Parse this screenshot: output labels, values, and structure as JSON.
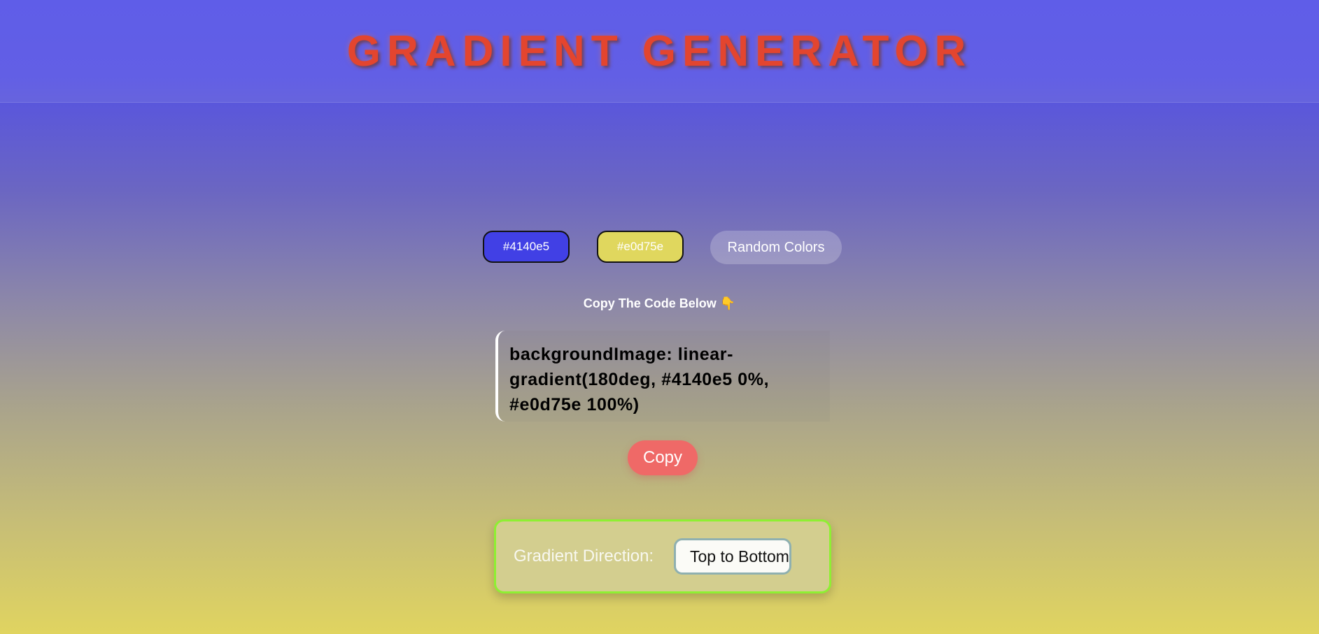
{
  "header": {
    "title": "GRADIENT GENERATOR"
  },
  "colors": {
    "color1_label": "#4140e5",
    "color2_label": "#e0d75e",
    "color1_hex": "#4140e5",
    "color2_hex": "#e0d75e",
    "random_label": "Random Colors"
  },
  "code": {
    "caption": "Copy The Code Below 👇",
    "text": "backgroundImage: linear-gradient(180deg, #4140e5 0%, #e0d75e 100%)",
    "copy_label": "Copy"
  },
  "direction": {
    "label": "Gradient Direction:",
    "selected": "Top to Bottom"
  }
}
